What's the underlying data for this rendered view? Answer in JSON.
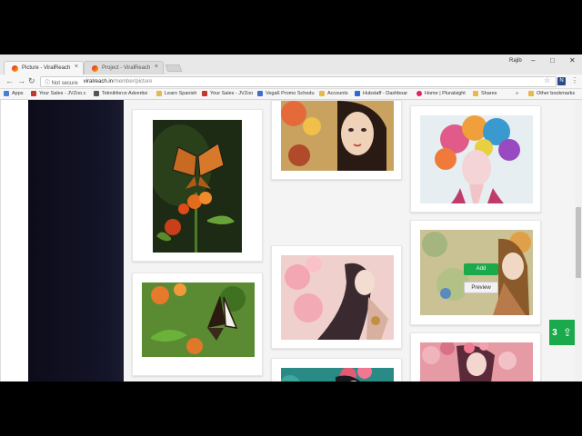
{
  "window": {
    "profile_name": "Rajib",
    "minimize": "–",
    "maximize": "□",
    "close": "✕"
  },
  "tabs": [
    {
      "title": "Picture - ViralReach",
      "active": true,
      "close": "×"
    },
    {
      "title": "Project - ViralReach",
      "active": false,
      "close": "×"
    }
  ],
  "nav": {
    "back": "←",
    "forward": "→",
    "reload": "↻"
  },
  "address": {
    "security": "ⓘ Not secure",
    "host": "viralreach.in",
    "path": "/member/picture"
  },
  "toolbar": {
    "star": "☆",
    "extension_label": "N",
    "menu": "⋮"
  },
  "bookmarks": [
    {
      "label": "Apps",
      "color": "#4a7fd8"
    },
    {
      "label": "Your Sales - JVZoo.c",
      "color": "#c0392b"
    },
    {
      "label": "Teknikforce Advertisi",
      "color": "#555555"
    },
    {
      "label": "Learn Spanish",
      "color": "#e8b84a"
    },
    {
      "label": "Your Sales - JVZoo",
      "color": "#c0392b"
    },
    {
      "label": "Vega6 Promo Schedu",
      "color": "#3c6fd1"
    },
    {
      "label": "Accounts",
      "color": "#e8b84a"
    },
    {
      "label": "Hubstaff - Dashboar",
      "color": "#2c6bd6"
    },
    {
      "label": "Home | Pluralsight",
      "color": "#e0245e"
    },
    {
      "label": "Shares",
      "color": "#e8b84a"
    },
    {
      "label": "»",
      "color": ""
    },
    {
      "label": "Other bookmarks",
      "color": "#e8b84a"
    }
  ],
  "gallery": {
    "hover_add": "Add",
    "hover_preview": "Preview",
    "images": [
      {
        "subject": "butterfly-on-flower",
        "colors": [
          "#1e2a14",
          "#d96a1a"
        ]
      },
      {
        "subject": "butterfly-on-leaf",
        "colors": [
          "#4a7a2a",
          "#2a1e10"
        ]
      },
      {
        "subject": "fantasy-girl-flowers",
        "colors": [
          "#c9a060",
          "#3a3020"
        ]
      },
      {
        "subject": "fantasy-girl-pink-blossoms",
        "colors": [
          "#f2c8cc",
          "#6a4050"
        ]
      },
      {
        "subject": "fantasy-girl-teal-peony",
        "colors": [
          "#2a8a8a",
          "#e0506a"
        ]
      },
      {
        "subject": "colorful-floral-headdress",
        "colors": [
          "#e05a8a",
          "#3a9ad0"
        ]
      },
      {
        "subject": "fantasy-girl-garden",
        "colors": [
          "#c8c090",
          "#8a6a3a"
        ]
      },
      {
        "subject": "fantasy-girl-pink",
        "colors": [
          "#e890a0",
          "#b05070"
        ]
      }
    ]
  },
  "upload": {
    "count": "3",
    "icon": "⇪"
  }
}
